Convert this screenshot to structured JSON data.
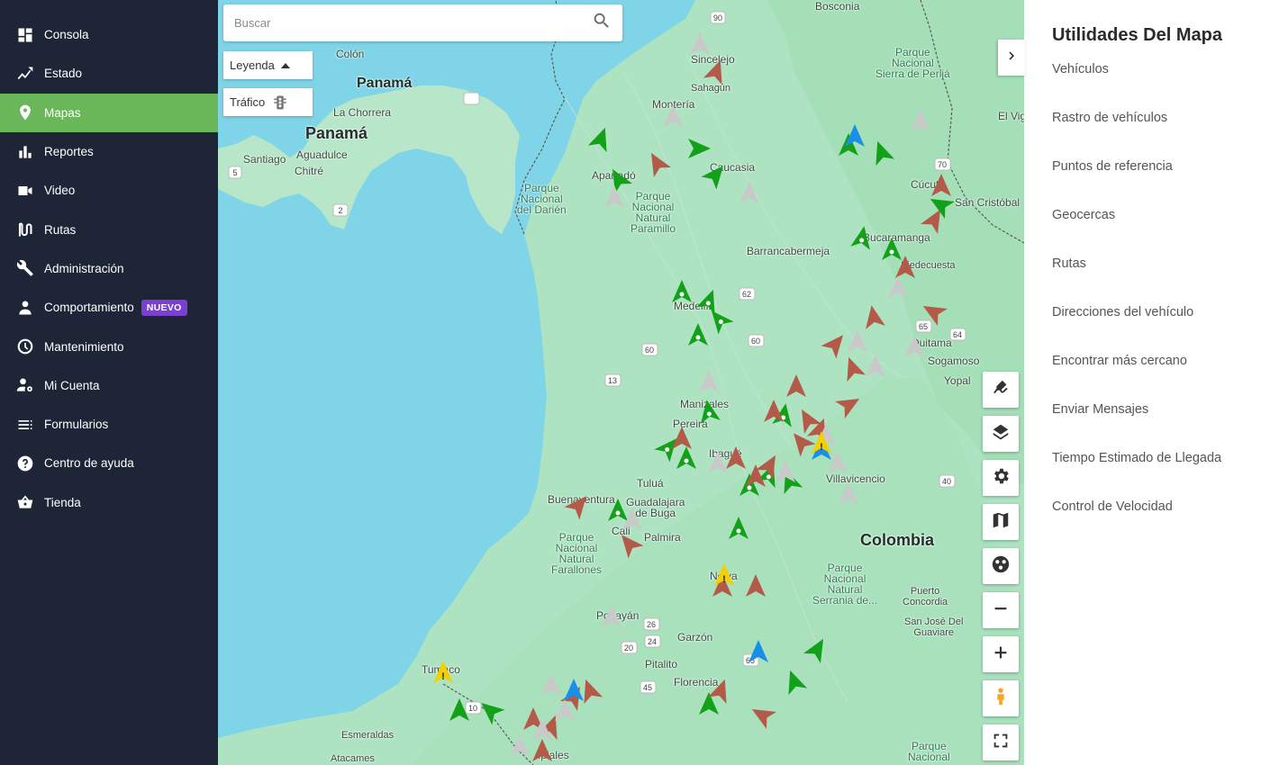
{
  "sidebar": {
    "items": [
      {
        "label": "Consola",
        "icon": "dashboard-icon"
      },
      {
        "label": "Estado",
        "icon": "trend-icon"
      },
      {
        "label": "Mapas",
        "icon": "map-pin-icon",
        "active": true
      },
      {
        "label": "Reportes",
        "icon": "bar-chart-icon"
      },
      {
        "label": "Video",
        "icon": "video-camera-icon"
      },
      {
        "label": "Rutas",
        "icon": "route-icon"
      },
      {
        "label": "Administración",
        "icon": "wrench-icon"
      },
      {
        "label": "Comportamiento",
        "icon": "person-icon",
        "badge": "NUEVO"
      },
      {
        "label": "Mantenimiento",
        "icon": "gauge-icon"
      },
      {
        "label": "Mi Cuenta",
        "icon": "account-settings-icon"
      },
      {
        "label": "Formularios",
        "icon": "list-icon"
      },
      {
        "label": "Centro de ayuda",
        "icon": "help-icon"
      },
      {
        "label": "Tienda",
        "icon": "basket-icon"
      }
    ],
    "active_color": "#6ab75a",
    "background": "#1d2536",
    "badge_color": "#7b3fd1"
  },
  "map": {
    "search_placeholder": "Buscar",
    "legend_label": "Leyenda",
    "traffic_label": "Tráfico",
    "places": {
      "colon": "Colón",
      "panama_city": "Panamá",
      "panama_country": "Panamá",
      "la_chorrera": "La Chorrera",
      "santiago": "Santiago",
      "aguadulce": "Aguadulce",
      "chitre": "Chitré",
      "sincelejo": "Sincelejo",
      "sahagun": "Sahagún",
      "monteria": "Montería",
      "caucasia": "Caucasia",
      "apartado": "Apartadó",
      "bosconia": "Bosconia",
      "cucuta": "Cúcuta",
      "san_cristobal": "San Cristóbal",
      "el_vigia": "El Vig",
      "bucaramanga": "Bucaramanga",
      "piedecuesta": "Piedecuesta",
      "barrancabermeja": "Barrancabermeja",
      "medellin": "Medellín",
      "duitama": "Duitama",
      "sogamoso": "Sogamoso",
      "yopal": "Yopal",
      "manizales": "Manizales",
      "pereira": "Pereira",
      "ibague": "Ibagué",
      "villavicencio": "Villavicencio",
      "tulua": "Tuluá",
      "guadalajara_de_buga": "Guadalajara\nde Buga",
      "buenaventura": "Buenaventura",
      "cali": "Cali",
      "palmira": "Palmira",
      "colombia": "Colombia",
      "neiva": "Neiva",
      "popayan": "Popayán",
      "garzon": "Garzón",
      "pitalito": "Pitalito",
      "florencia": "Florencia",
      "tumaco": "Tumaco",
      "esmeraldas": "Esmeraldas",
      "atacames": "Atacames",
      "ipiales": "Ipiales",
      "puerto_concordia": "Puerto\nConcordia",
      "san_jose_del_guaviare": "San José Del\nGuaviare"
    },
    "parks": {
      "darien": "Parque\nNacional\ndel Darién",
      "paramillo": "Parque\nNacional\nNatural\nParamillo",
      "perija": "Parque\nNacional\nSierra de Perijá",
      "farallones": "Parque\nNacional\nNatural\nFarallones",
      "macarena": "Parque\nNacional\nNatural\nSerrania de...",
      "bottom": "Parque\nNacional"
    },
    "road_shields": [
      "90",
      "5",
      "2",
      "62",
      "60",
      "60",
      "13",
      "70",
      "65",
      "64",
      "40",
      "26",
      "20",
      "24",
      "45",
      "65",
      "10"
    ],
    "marker_colors": {
      "green": "#13a11a",
      "red": "#b35a48",
      "gray": "#c9c9c9",
      "blue": "#1a8fe6",
      "yellow": "#f4d000"
    }
  },
  "controls": [
    "draw-icon",
    "layers-icon",
    "settings-icon",
    "map-type-icon",
    "cluster-icon",
    "zoom-out-icon",
    "zoom-in-icon",
    "pegman-icon",
    "fullscreen-icon"
  ],
  "panel": {
    "title": "Utilidades Del Mapa",
    "items": [
      "Vehículos",
      "Rastro de vehículos",
      "Puntos de referencia",
      "Geocercas",
      "Rutas",
      "Direcciones del vehículo",
      "Encontrar más cercano",
      "Enviar Mensajes",
      "Tiempo Estimado de Llegada",
      "Control de Velocidad"
    ]
  }
}
